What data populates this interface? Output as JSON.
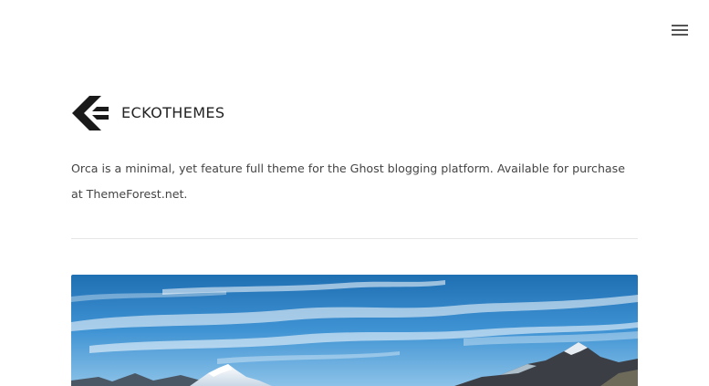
{
  "header": {
    "menu_icon": "hamburger-menu-icon"
  },
  "brand": {
    "logo_icon": "eckothemes-logo-icon",
    "name": "ECKOTHEMES"
  },
  "intro": {
    "description": "Orca is a minimal, yet feature full theme for the Ghost blogging platform. Available for purchase at ThemeForest.net."
  },
  "post": {
    "feature_image": "mountain-landscape-sky-photo"
  },
  "colors": {
    "text": "#444444",
    "brand_text": "#222222",
    "logo": "#1a1a1a",
    "divider": "#e6e6e6",
    "sky": "#2f86c9"
  }
}
